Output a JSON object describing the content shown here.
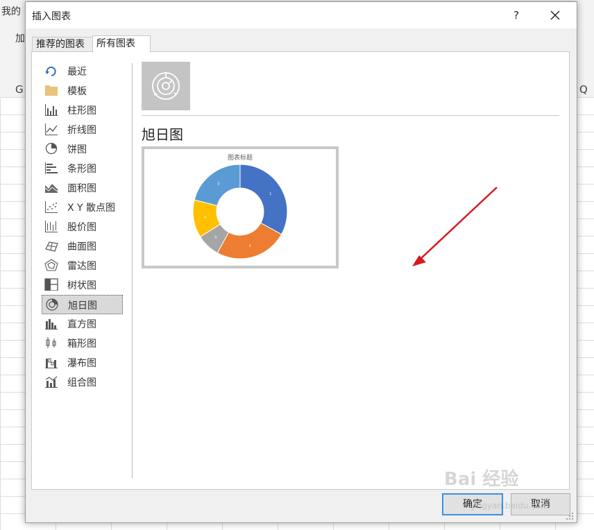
{
  "background": {
    "top_left_text": "我的",
    "ribbon_text": "加",
    "column_left": "G",
    "column_right": "Q"
  },
  "dialog": {
    "title": "插入图表",
    "help_label": "?",
    "tabs": [
      {
        "label": "推荐的图表"
      },
      {
        "label": "所有图表"
      }
    ],
    "sidebar": [
      {
        "label": "最近",
        "icon": "recent-icon"
      },
      {
        "label": "模板",
        "icon": "folder-icon"
      },
      {
        "label": "柱形图",
        "icon": "column-chart-icon"
      },
      {
        "label": "折线图",
        "icon": "line-chart-icon"
      },
      {
        "label": "饼图",
        "icon": "pie-chart-icon"
      },
      {
        "label": "条形图",
        "icon": "bar-chart-icon"
      },
      {
        "label": "面积图",
        "icon": "area-chart-icon"
      },
      {
        "label": "X Y 散点图",
        "icon": "scatter-chart-icon"
      },
      {
        "label": "股价图",
        "icon": "stock-chart-icon"
      },
      {
        "label": "曲面图",
        "icon": "surface-chart-icon"
      },
      {
        "label": "雷达图",
        "icon": "radar-chart-icon"
      },
      {
        "label": "树状图",
        "icon": "treemap-chart-icon"
      },
      {
        "label": "旭日图",
        "icon": "sunburst-chart-icon"
      },
      {
        "label": "直方图",
        "icon": "histogram-chart-icon"
      },
      {
        "label": "箱形图",
        "icon": "box-whisker-chart-icon"
      },
      {
        "label": "瀑布图",
        "icon": "waterfall-chart-icon"
      },
      {
        "label": "组合图",
        "icon": "combo-chart-icon"
      }
    ],
    "selected_index": 12,
    "section_title": "旭日图",
    "ok_label": "确定",
    "cancel_label": "取消"
  },
  "chart_data": {
    "type": "pie",
    "subtype": "sunburst",
    "title": "图表标题",
    "categories": [
      "1",
      "2",
      "3",
      "4",
      "5"
    ],
    "values": [
      33,
      25,
      21,
      13,
      8
    ],
    "order": [
      "1",
      "2",
      "5",
      "4",
      "3"
    ],
    "colors": [
      "#4472C4",
      "#ED7D31",
      "#5B9BD5",
      "#FFC000",
      "#A5A5A5"
    ]
  },
  "colors": {
    "accent": "#3c8ee6",
    "arrow": "#d9161f",
    "selected_bg": "#d9d9d9"
  },
  "watermark": {
    "text": "Bai 经验",
    "sub": "jingyan.baidu.com"
  }
}
